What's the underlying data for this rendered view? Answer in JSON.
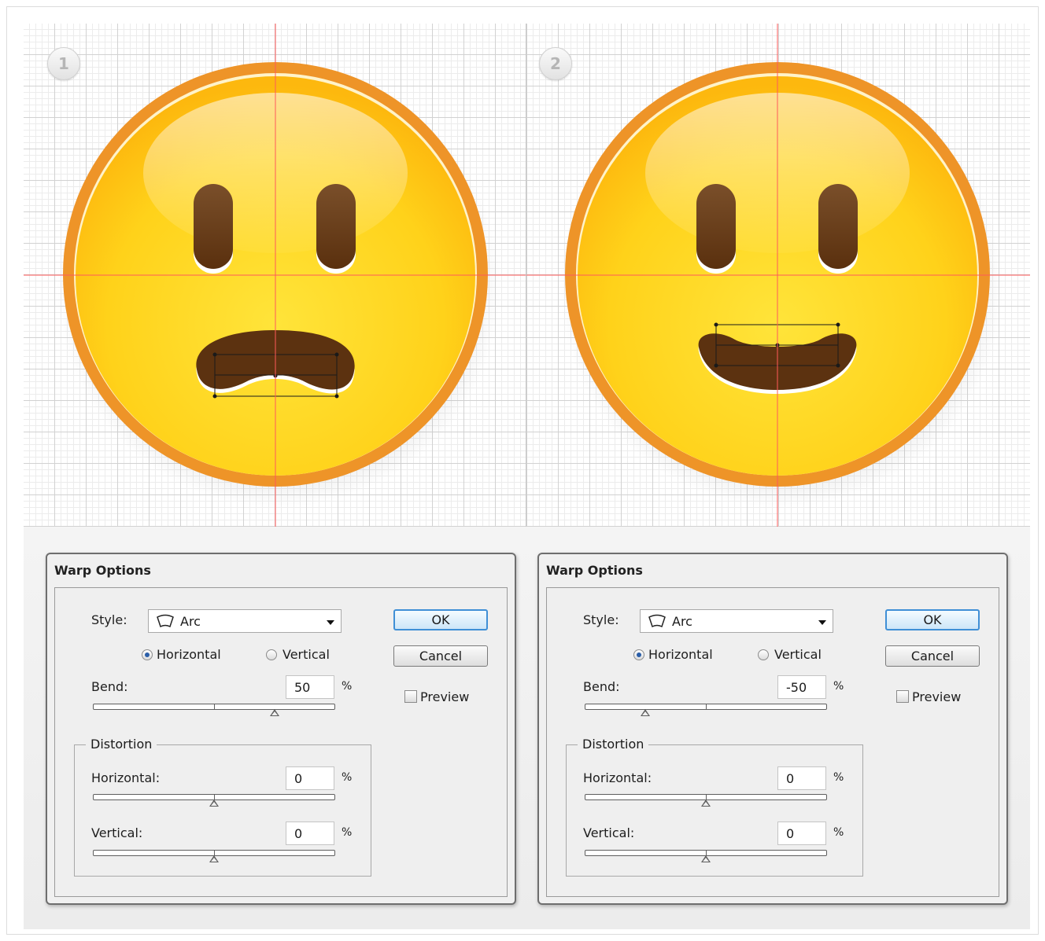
{
  "steps": [
    {
      "number": "1"
    },
    {
      "number": "2"
    }
  ],
  "colors": {
    "face_yellow": "#ffd21a",
    "face_rim": "#ee9428",
    "feature_brown": "#5c3210",
    "guide_red": "#ff5a5a"
  },
  "dialogs": [
    {
      "title": "Warp Options",
      "style_label": "Style:",
      "style_icon": "arc-warp-icon",
      "style_value": "Arc",
      "orientation": {
        "horizontal_label": "Horizontal",
        "vertical_label": "Vertical",
        "selected": "Horizontal"
      },
      "bend_label": "Bend:",
      "bend_value": "50",
      "bend_fraction": 0.75,
      "percent": "%",
      "distortion_label": "Distortion",
      "dist_horizontal_label": "Horizontal:",
      "dist_horizontal_value": "0",
      "dist_horizontal_fraction": 0.5,
      "dist_vertical_label": "Vertical:",
      "dist_vertical_value": "0",
      "dist_vertical_fraction": 0.5,
      "ok_label": "OK",
      "cancel_label": "Cancel",
      "preview_label": "Preview",
      "preview_checked": false
    },
    {
      "title": "Warp Options",
      "style_label": "Style:",
      "style_icon": "arc-warp-icon",
      "style_value": "Arc",
      "orientation": {
        "horizontal_label": "Horizontal",
        "vertical_label": "Vertical",
        "selected": "Horizontal"
      },
      "bend_label": "Bend:",
      "bend_value": "-50",
      "bend_fraction": 0.25,
      "percent": "%",
      "distortion_label": "Distortion",
      "dist_horizontal_label": "Horizontal:",
      "dist_horizontal_value": "0",
      "dist_horizontal_fraction": 0.5,
      "dist_vertical_label": "Vertical:",
      "dist_vertical_value": "0",
      "dist_vertical_fraction": 0.5,
      "ok_label": "OK",
      "cancel_label": "Cancel",
      "preview_label": "Preview",
      "preview_checked": false
    }
  ]
}
